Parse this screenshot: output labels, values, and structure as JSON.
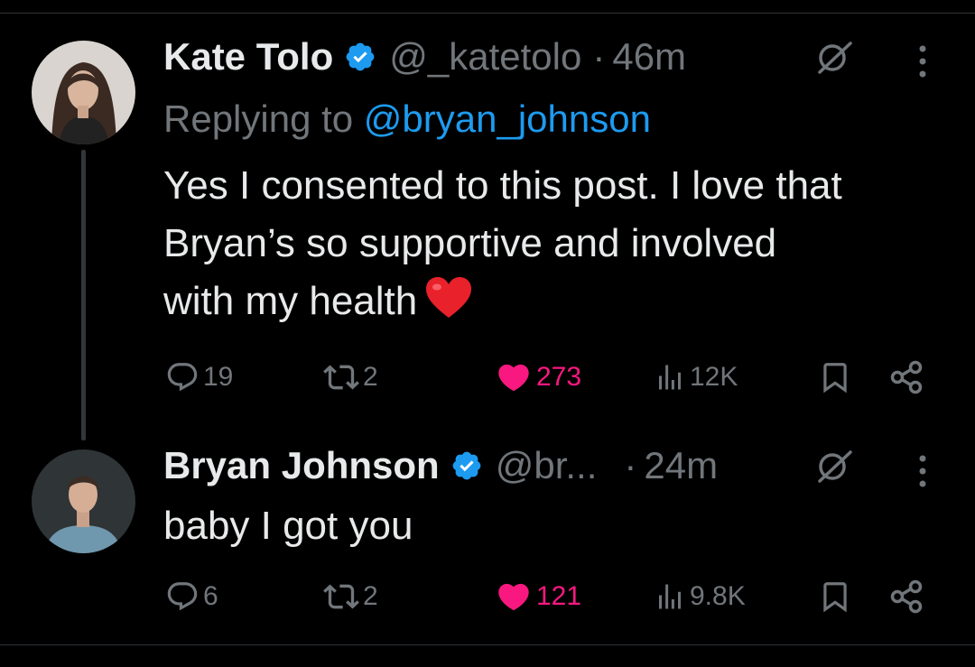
{
  "posts": [
    {
      "name": "Kate Tolo",
      "handle": "@_katetolo",
      "dot": "·",
      "time": "46m",
      "replying_prefix": "Replying to",
      "replying_mention": "@bryan_johnson",
      "text_lines": [
        "Yes I consented to this post. I love that",
        "Bryan’s so supportive and involved",
        "with my health"
      ],
      "emoji": "red-heart",
      "stats": {
        "replies": "19",
        "reposts": "2",
        "likes": "273",
        "views": "12K"
      }
    },
    {
      "name": "Bryan Johnson",
      "handle": "@br...",
      "dot": "·",
      "time": "24m",
      "text": "baby I got you",
      "stats": {
        "replies": "6",
        "reposts": "2",
        "likes": "121",
        "views": "9.8K"
      }
    }
  ],
  "colors": {
    "background": "#000000",
    "text": "#e7e9ea",
    "secondary": "#71767b",
    "mention": "#1d9bf0",
    "like": "#f91880",
    "verified": "#1d9bf0"
  }
}
